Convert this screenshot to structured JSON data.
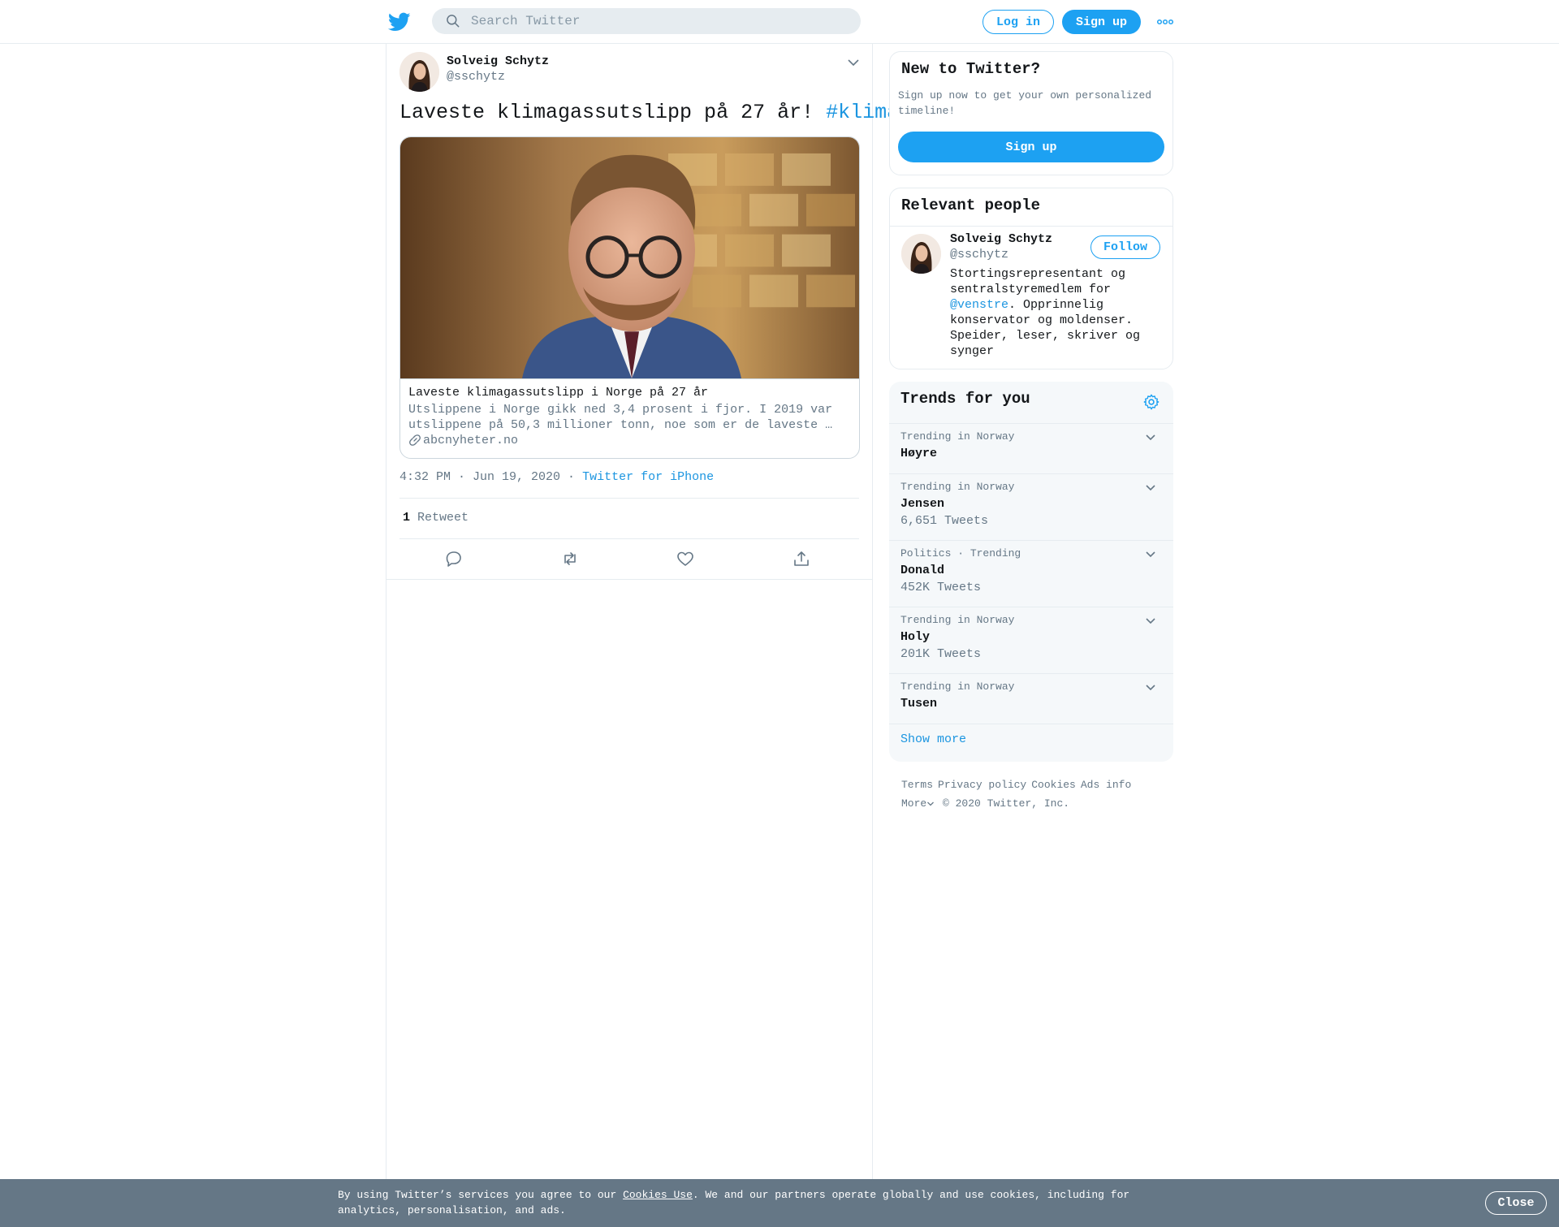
{
  "header": {
    "search_placeholder": "Search Twitter",
    "login_label": "Log in",
    "signup_label": "Sign up"
  },
  "tweet": {
    "author_name": "Solveig Schytz",
    "author_handle": "@sschytz",
    "text": "Laveste klimagassutslipp på 27 år! ",
    "hashtag": "#klima",
    "card": {
      "title": "Laveste klimagassutslipp i Norge på 27 år",
      "description": "Utslippene i Norge gikk ned 3,4 prosent i fjor. I 2019 var utslippene på 50,3 millioner tonn, noe som er de laveste …",
      "domain": "abcnyheter.no"
    },
    "timestamp": "4:32 PM · Jun 19, 2020",
    "meta_sep": " · ",
    "source": "Twitter for iPhone",
    "retweet_count": "1",
    "retweet_label": "Retweet"
  },
  "new_to_twitter": {
    "title": "New to Twitter?",
    "subtitle": "Sign up now to get your own personalized timeline!",
    "button_label": "Sign up"
  },
  "relevant_people": {
    "title": "Relevant people",
    "name": "Solveig Schytz",
    "handle": "@sschytz",
    "follow_label": "Follow",
    "bio_before": "Stortingsrepresentant og sentralstyremedlem for ",
    "bio_mention": "@venstre",
    "bio_after": ". Opprinnelig konservator og moldenser. Speider, leser, skriver og synger"
  },
  "trends": {
    "title": "Trends for you",
    "items": [
      {
        "context": "Trending in Norway",
        "name": "Høyre",
        "count": ""
      },
      {
        "context": "Trending in Norway",
        "name": "Jensen",
        "count": "6,651 Tweets"
      },
      {
        "context": "Politics · Trending",
        "name": "Donald",
        "count": "452K Tweets"
      },
      {
        "context": "Trending in Norway",
        "name": "Holy",
        "count": "201K Tweets"
      },
      {
        "context": "Trending in Norway",
        "name": "Tusen",
        "count": ""
      }
    ],
    "show_more": "Show more"
  },
  "footer": {
    "links": [
      "Terms",
      "Privacy policy",
      "Cookies",
      "Ads info"
    ],
    "more": "More",
    "copyright": "© 2020 Twitter, Inc."
  },
  "cookie_banner": {
    "text_before": "By using Twitter’s services you agree to our ",
    "link": "Cookies Use",
    "text_after": ". We and our partners operate globally and use cookies, including for analytics, personalisation, and ads.",
    "close_label": "Close"
  },
  "colors": {
    "brand": "#1da1f2",
    "link": "#1b95e0",
    "muted": "#657786",
    "banner": "#657786"
  }
}
